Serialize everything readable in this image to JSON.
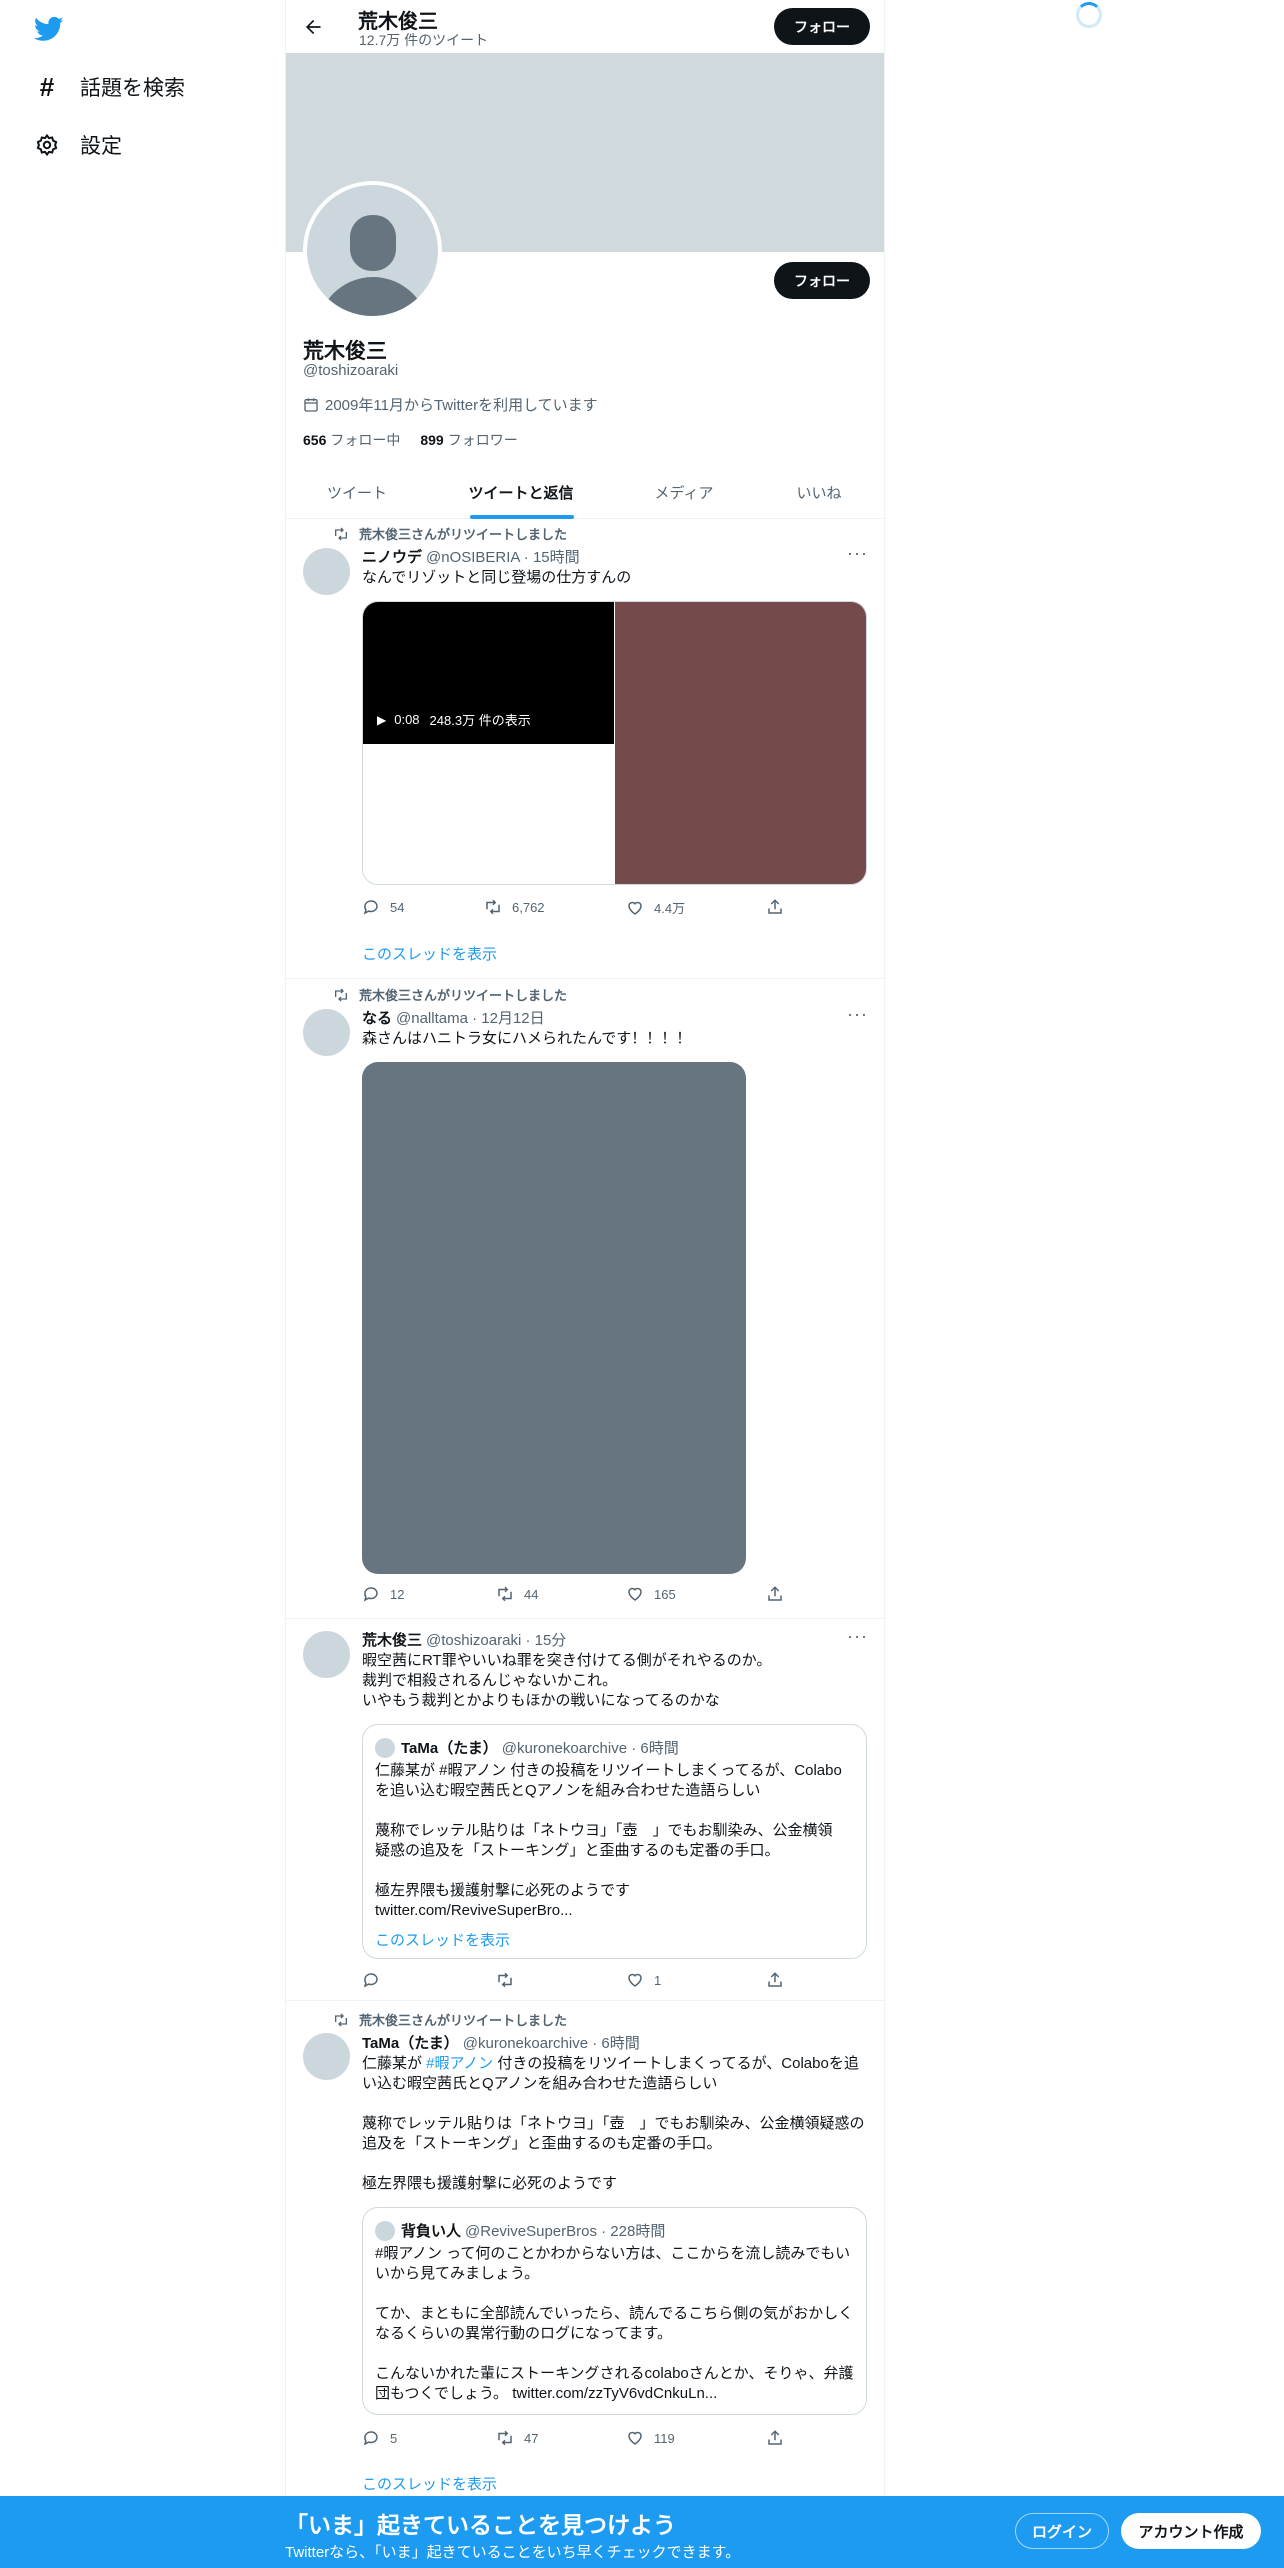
{
  "nav": {
    "explore_label": "話題を検索",
    "settings_label": "設定"
  },
  "header": {
    "name": "荒木俊三",
    "tweet_count": "12.7万 件のツイート",
    "follow_label": "フォロー"
  },
  "profile": {
    "name": "荒木俊三",
    "handle": "@toshizoaraki",
    "joined": "2009年11月からTwitterを利用しています",
    "following_count": "656",
    "following_label": "フォロー中",
    "followers_count": "899",
    "followers_label": "フォロワー",
    "follow_label": "フォロー"
  },
  "tabs": [
    {
      "label": "ツイート"
    },
    {
      "label": "ツイートと返信"
    },
    {
      "label": "メディア"
    },
    {
      "label": "いいね"
    }
  ],
  "tweets": [
    {
      "retweet_label": "荒木俊三さんがリツイートしました",
      "name": "ニノウデ",
      "handle": "@nOSIBERIA · 15時間",
      "text": "なんでリゾットと同じ登場の仕方すんの",
      "video_duration": "0:08",
      "video_views": "248.3万 件の表示",
      "replies": "54",
      "retweets": "6,762",
      "likes": "4.4万",
      "thread_link": "このスレッドを表示"
    },
    {
      "retweet_label": "荒木俊三さんがリツイートしました",
      "name": "なる",
      "handle": "@nalltama · 12月12日",
      "text": "森さんはハニトラ女にハメられたんです！！！！",
      "replies": "12",
      "retweets": "44",
      "likes": "165"
    },
    {
      "name": "荒木俊三",
      "handle": "@toshizoaraki · 15分",
      "text": "暇空茜にRT罪やいいね罪を突き付けてる側がそれやるのか。\n裁判で相殺されるんじゃないかこれ。\nいやもう裁判とかよりもほかの戦いになってるのかな",
      "quote": {
        "name": "TaMa（たま）",
        "handle": "@kuronekoarchive · 6時間",
        "text": "仁藤某が #暇アノン 付きの投稿をリツイートしまくってるが、Colabo\nを追い込む暇空茜氏とQアノンを組み合わせた造語らしい\n\n蔑称でレッテル貼りは「ネトウヨ」「壺　」でもお馴染み、公金横領\n疑惑の追及を「ストーキング」と歪曲するのも定番の手口。\n\n極左界隈も援護射撃に必死のようです\ntwitter.com/ReviveSuperBro...",
        "thread_link": "このスレッドを表示"
      },
      "replies": "",
      "retweets": "",
      "likes": "1"
    },
    {
      "retweet_label": "荒木俊三さんがリツイートしました",
      "name": "TaMa（たま）",
      "handle": "@kuronekoarchive · 6時間",
      "text_before_tag": "仁藤某が ",
      "hashtag": "#暇アノン",
      "text_after_tag": " 付きの投稿をリツイートしまくってるが、Colaboを追い込む暇空茜氏とQアノンを組み合わせた造語らしい\n\n蔑称でレッテル貼りは「ネトウヨ」「壺　」でもお馴染み、公金横領疑惑の追及を「ストーキング」と歪曲するのも定番の手口。\n\n極左界隈も援護射撃に必死のようです",
      "quote": {
        "name": "背負い人",
        "handle": "@ReviveSuperBros · 228時間",
        "text": "#暇アノン って何のことかわからない方は、ここからを流し読みでもい\nいから見てみましょう。\n\nてか、まともに全部読んでいったら、読んでるこちら側の気がおかしく\nなるくらいの異常行動のログになってます。\n\nこんないかれた輩にストーキングされるcolaboさんとか、そりゃ、弁護\n団もつくでしょう。 twitter.com/zzTyV6vdCnkuLn..."
      },
      "replies": "5",
      "retweets": "47",
      "likes": "119",
      "thread_link": "このスレッドを表示"
    }
  ],
  "bottom_bar": {
    "title": "「いま」起きていることを見つけよう",
    "subtitle": "Twitterなら、「いま」起きていることをいち早くチェックできます。",
    "login_label": "ログイン",
    "signup_label": "アカウント作成"
  },
  "colors": {
    "accent": "#1d9bf0",
    "banner": "#cfd9de",
    "media_dark": "#754a4a",
    "media_gray": "#66757f"
  }
}
